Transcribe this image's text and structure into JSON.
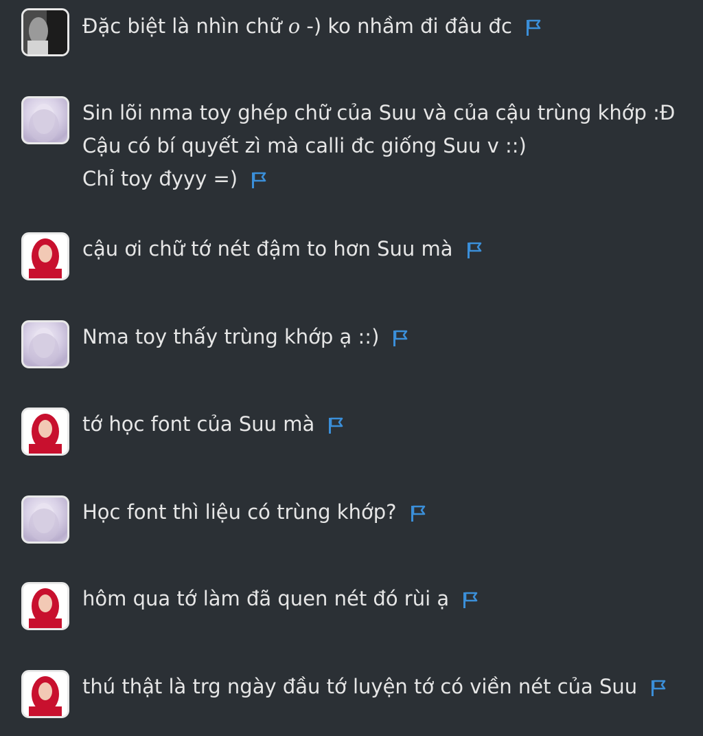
{
  "colors": {
    "background": "#2b3035",
    "text": "#e6e6e6",
    "flag": "#3b8fd9",
    "avatar_border": "#e9e9e9"
  },
  "messages": [
    {
      "avatar": "grey-photo-avatar",
      "lines": [
        "Đặc biệt là nhìn chữ ",
        "o",
        " -) ko nhầm đi đâu đc"
      ]
    },
    {
      "avatar": "lavender-avatar",
      "lines": [
        "Sin lõi nma toy ghép chữ của Suu và của cậu trùng khớp :Đ",
        "Cậu có bí quyết zì mà calli đc giống Suu v ::)",
        "Chỉ toy đyyy =)"
      ]
    },
    {
      "avatar": "red-hair-avatar",
      "lines": [
        "cậu ơi chữ tớ nét đậm to hơn Suu mà"
      ]
    },
    {
      "avatar": "lavender-avatar",
      "lines": [
        "Nma toy thấy trùng khớp ạ ::)"
      ]
    },
    {
      "avatar": "red-hair-avatar",
      "lines": [
        "tớ học font của Suu mà"
      ]
    },
    {
      "avatar": "lavender-avatar",
      "lines": [
        "Học font thì liệu có trùng khớp?"
      ]
    },
    {
      "avatar": "red-hair-avatar",
      "lines": [
        "hôm qua tớ làm đã quen nét đó rùi ạ"
      ]
    },
    {
      "avatar": "red-hair-avatar",
      "lines": [
        "thú thật là trg ngày đầu tớ luyện tớ có viền nét của Suu"
      ]
    }
  ],
  "icons": {
    "report": "flag-icon"
  }
}
